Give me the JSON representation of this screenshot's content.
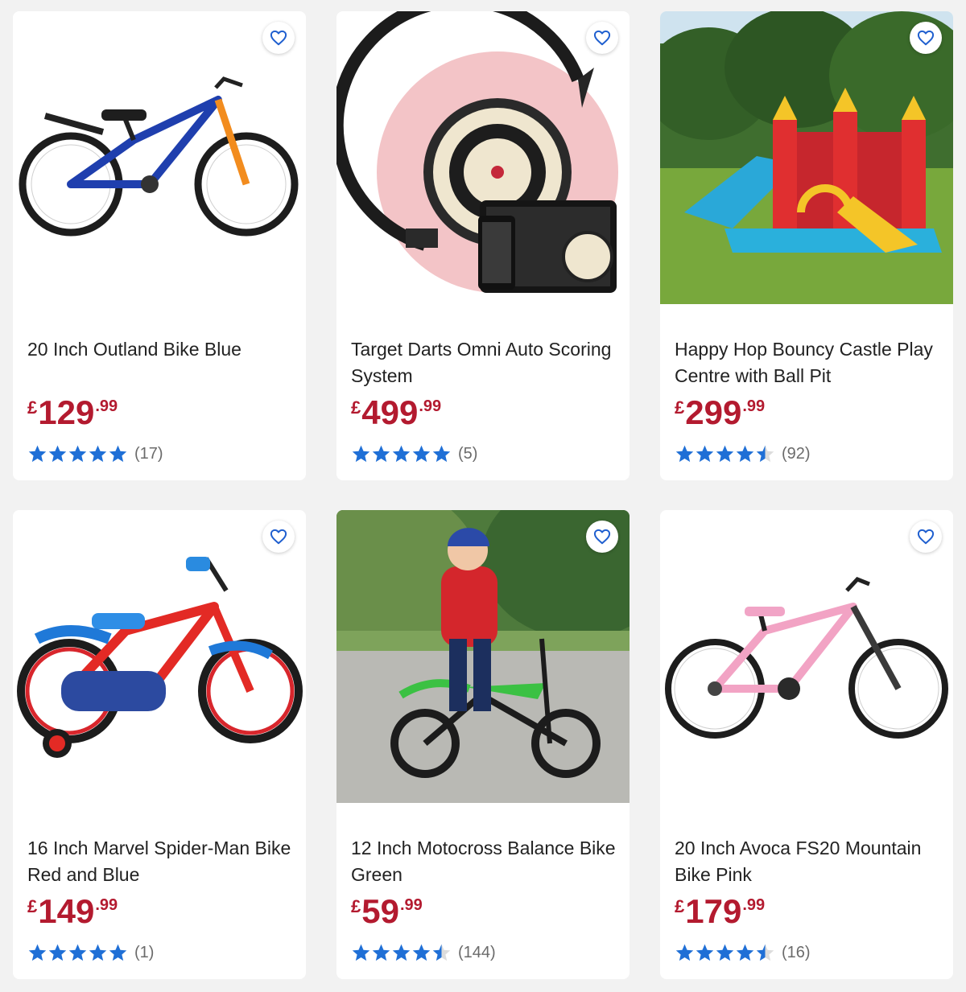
{
  "products": [
    {
      "title": "20 Inch Outland Bike Blue",
      "price_currency": "£",
      "price_whole": "129",
      "price_decimal": ".99",
      "rating": 5,
      "review_count": "(17)",
      "image": "blue-bike"
    },
    {
      "title": "Target Darts Omni Auto Scoring System",
      "price_currency": "£",
      "price_whole": "499",
      "price_decimal": ".99",
      "rating": 5,
      "review_count": "(5)",
      "image": "dartboard"
    },
    {
      "title": "Happy Hop Bouncy Castle Play Centre with Ball Pit",
      "price_currency": "£",
      "price_whole": "299",
      "price_decimal": ".99",
      "rating": 4.5,
      "review_count": "(92)",
      "image": "bouncy-castle"
    },
    {
      "title": "16 Inch Marvel Spider-Man Bike Red and Blue",
      "price_currency": "£",
      "price_whole": "149",
      "price_decimal": ".99",
      "rating": 5,
      "review_count": "(1)",
      "image": "spiderman-bike"
    },
    {
      "title": "12 Inch Motocross Balance Bike Green",
      "price_currency": "£",
      "price_whole": "59",
      "price_decimal": ".99",
      "rating": 4.5,
      "review_count": "(144)",
      "image": "balance-bike"
    },
    {
      "title": "20 Inch Avoca FS20 Mountain Bike Pink",
      "price_currency": "£",
      "price_whole": "179",
      "price_decimal": ".99",
      "rating": 4.5,
      "review_count": "(16)",
      "image": "pink-bike"
    }
  ],
  "colors": {
    "price": "#b31a2f",
    "star": "#1f6fd6",
    "star_empty": "#dcdcdc",
    "heart": "#1f5fcf"
  },
  "icons": {
    "wishlist": "heart-icon",
    "rating": "star-icon"
  }
}
